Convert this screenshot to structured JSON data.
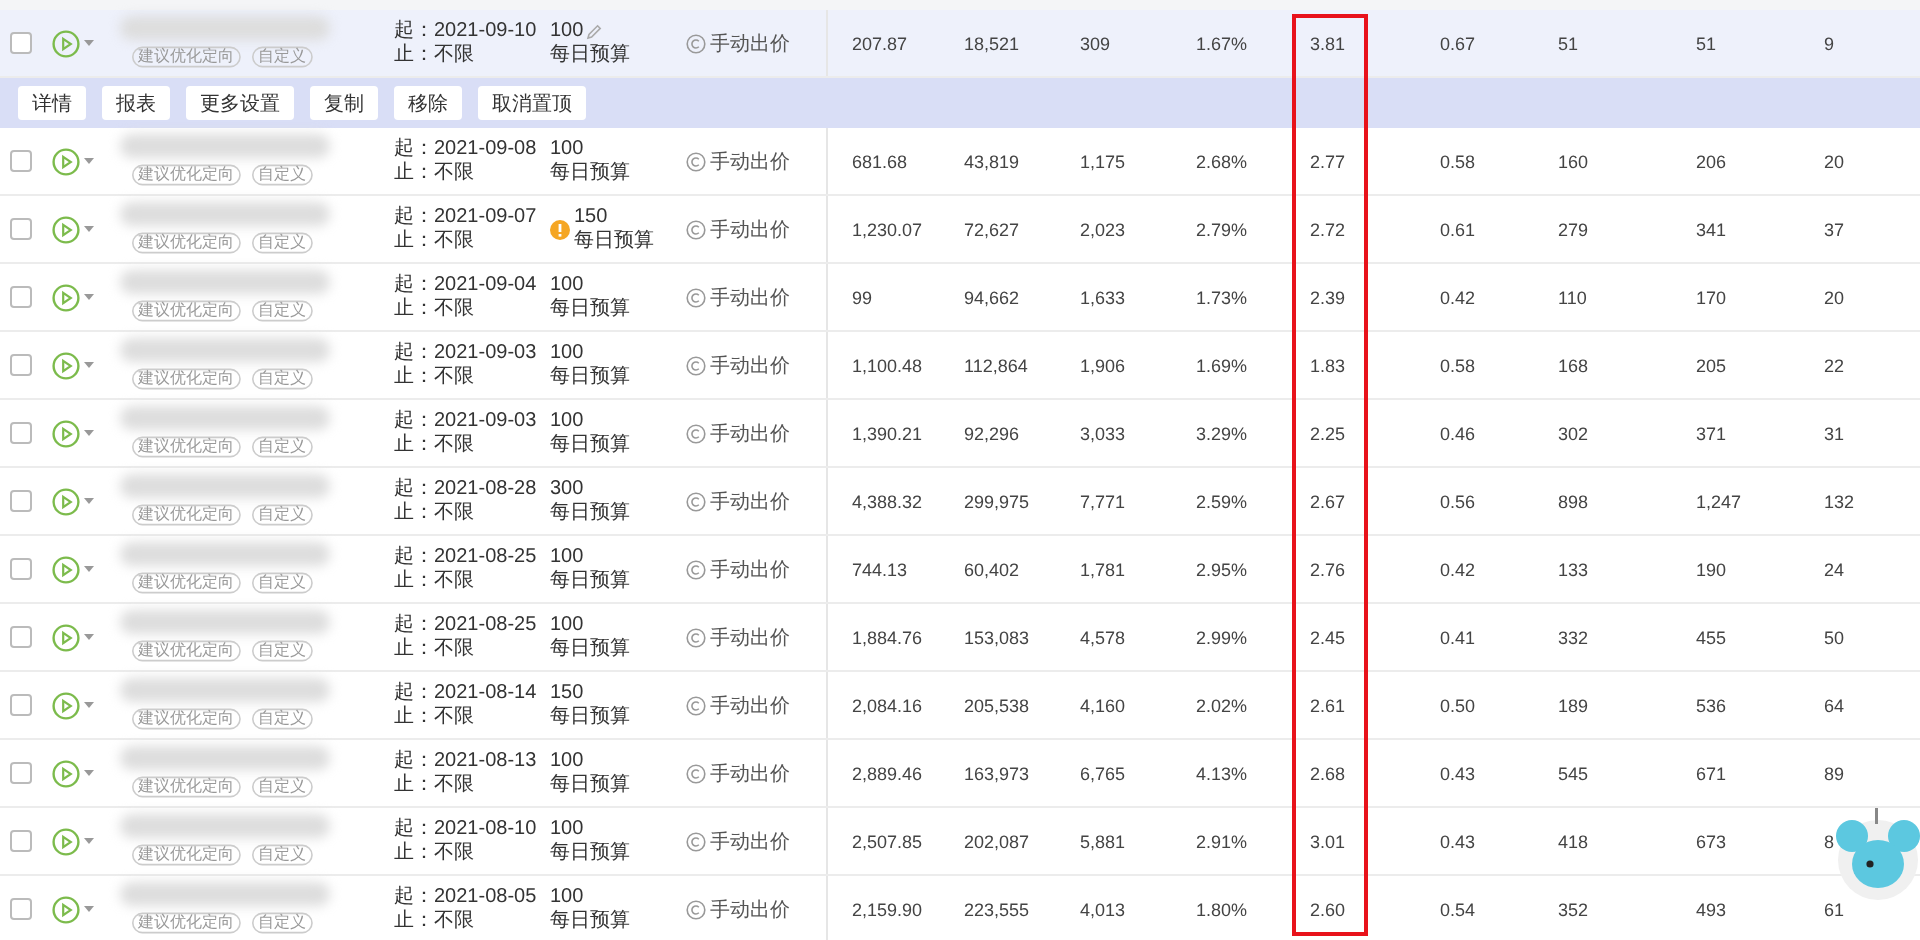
{
  "metric_columns": [
    {
      "highlighted": false
    },
    {
      "highlighted": false
    },
    {
      "highlighted": false
    },
    {
      "highlighted": false
    },
    {
      "highlighted": true
    },
    {
      "highlighted": false
    },
    {
      "highlighted": false
    },
    {
      "highlighted": false
    },
    {
      "highlighted": false
    }
  ],
  "action_bar": {
    "buttons": [
      "详情",
      "报表",
      "更多设置",
      "复制",
      "移除",
      "取消置顶"
    ]
  },
  "rows": [
    {
      "selected": true,
      "checked": false,
      "tags": [
        "建议优化定向",
        "自定义"
      ],
      "start": "起：2021-09-10",
      "end": "止：不限",
      "warning": false,
      "budget": "100",
      "budget_label": "每日预算",
      "bid": "手动出价",
      "metrics": [
        "207.87",
        "18,521",
        "309",
        "1.67%",
        "3.81",
        "0.67",
        "51",
        "51",
        "9"
      ]
    },
    {
      "selected": false,
      "checked": false,
      "tags": [
        "建议优化定向",
        "自定义"
      ],
      "start": "起：2021-09-08",
      "end": "止：不限",
      "warning": false,
      "budget": "100",
      "budget_label": "每日预算",
      "bid": "手动出价",
      "metrics": [
        "681.68",
        "43,819",
        "1,175",
        "2.68%",
        "2.77",
        "0.58",
        "160",
        "206",
        "20"
      ]
    },
    {
      "selected": false,
      "checked": false,
      "tags": [
        "建议优化定向",
        "自定义"
      ],
      "start": "起：2021-09-07",
      "end": "止：不限",
      "warning": true,
      "budget": "150",
      "budget_label": "每日预算",
      "bid": "手动出价",
      "metrics": [
        "1,230.07",
        "72,627",
        "2,023",
        "2.79%",
        "2.72",
        "0.61",
        "279",
        "341",
        "37"
      ]
    },
    {
      "selected": false,
      "checked": false,
      "tags": [
        "建议优化定向",
        "自定义"
      ],
      "start": "起：2021-09-04",
      "end": "止：不限",
      "warning": false,
      "budget": "100",
      "budget_label": "每日预算",
      "bid": "手动出价",
      "metrics": [
        "99",
        "94,662",
        "1,633",
        "1.73%",
        "2.39",
        "0.42",
        "110",
        "170",
        "20"
      ]
    },
    {
      "selected": false,
      "checked": false,
      "tags": [
        "建议优化定向",
        "自定义"
      ],
      "start": "起：2021-09-03",
      "end": "止：不限",
      "warning": false,
      "budget": "100",
      "budget_label": "每日预算",
      "bid": "手动出价",
      "metrics": [
        "1,100.48",
        "112,864",
        "1,906",
        "1.69%",
        "1.83",
        "0.58",
        "168",
        "205",
        "22"
      ]
    },
    {
      "selected": false,
      "checked": false,
      "tags": [
        "建议优化定向",
        "自定义"
      ],
      "start": "起：2021-09-03",
      "end": "止：不限",
      "warning": false,
      "budget": "100",
      "budget_label": "每日预算",
      "bid": "手动出价",
      "metrics": [
        "1,390.21",
        "92,296",
        "3,033",
        "3.29%",
        "2.25",
        "0.46",
        "302",
        "371",
        "31"
      ]
    },
    {
      "selected": false,
      "checked": false,
      "tags": [
        "建议优化定向",
        "自定义"
      ],
      "start": "起：2021-08-28",
      "end": "止：不限",
      "warning": false,
      "budget": "300",
      "budget_label": "每日预算",
      "bid": "手动出价",
      "metrics": [
        "4,388.32",
        "299,975",
        "7,771",
        "2.59%",
        "2.67",
        "0.56",
        "898",
        "1,247",
        "132"
      ]
    },
    {
      "selected": false,
      "checked": false,
      "tags": [
        "建议优化定向",
        "自定义"
      ],
      "start": "起：2021-08-25",
      "end": "止：不限",
      "warning": false,
      "budget": "100",
      "budget_label": "每日预算",
      "bid": "手动出价",
      "metrics": [
        "744.13",
        "60,402",
        "1,781",
        "2.95%",
        "2.76",
        "0.42",
        "133",
        "190",
        "24"
      ]
    },
    {
      "selected": false,
      "checked": false,
      "tags": [
        "建议优化定向",
        "自定义"
      ],
      "start": "起：2021-08-25",
      "end": "止：不限",
      "warning": false,
      "budget": "100",
      "budget_label": "每日预算",
      "bid": "手动出价",
      "metrics": [
        "1,884.76",
        "153,083",
        "4,578",
        "2.99%",
        "2.45",
        "0.41",
        "332",
        "455",
        "50"
      ]
    },
    {
      "selected": false,
      "checked": false,
      "tags": [
        "建议优化定向",
        "自定义"
      ],
      "start": "起：2021-08-14",
      "end": "止：不限",
      "warning": false,
      "budget": "150",
      "budget_label": "每日预算",
      "bid": "手动出价",
      "metrics": [
        "2,084.16",
        "205,538",
        "4,160",
        "2.02%",
        "2.61",
        "0.50",
        "189",
        "536",
        "64"
      ]
    },
    {
      "selected": false,
      "checked": false,
      "tags": [
        "建议优化定向",
        "自定义"
      ],
      "start": "起：2021-08-13",
      "end": "止：不限",
      "warning": false,
      "budget": "100",
      "budget_label": "每日预算",
      "bid": "手动出价",
      "metrics": [
        "2,889.46",
        "163,973",
        "6,765",
        "4.13%",
        "2.68",
        "0.43",
        "545",
        "671",
        "89"
      ]
    },
    {
      "selected": false,
      "checked": false,
      "tags": [
        "建议优化定向",
        "自定义"
      ],
      "start": "起：2021-08-10",
      "end": "止：不限",
      "warning": false,
      "budget": "100",
      "budget_label": "每日预算",
      "bid": "手动出价",
      "metrics": [
        "2,507.85",
        "202,087",
        "5,881",
        "2.91%",
        "3.01",
        "0.43",
        "418",
        "673",
        "8"
      ]
    },
    {
      "selected": false,
      "checked": false,
      "tags": [
        "建议优化定向",
        "自定义"
      ],
      "start": "起：2021-08-05",
      "end": "止：不限",
      "warning": false,
      "budget": "100",
      "budget_label": "每日预算",
      "bid": "手动出价",
      "metrics": [
        "2,159.90",
        "223,555",
        "4,013",
        "1.80%",
        "2.60",
        "0.54",
        "352",
        "493",
        "61"
      ]
    }
  ]
}
